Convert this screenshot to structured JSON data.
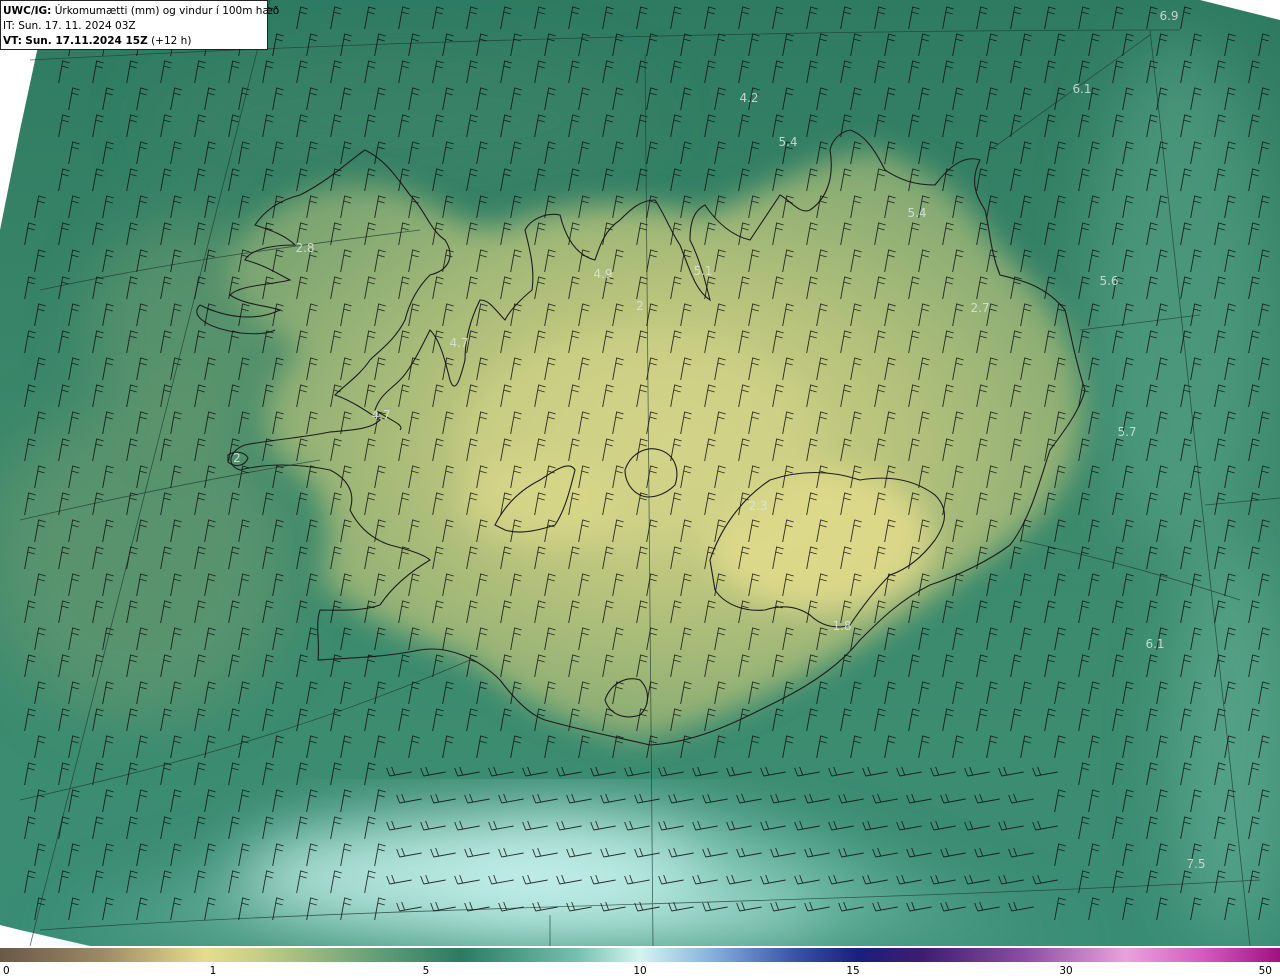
{
  "header": {
    "model": "UWC/IG:",
    "title": "Úrkomumætti (mm) og vindur í 100m hæð",
    "initial_time": "IT: Sun. 17. 11. 2024 03Z",
    "valid_prefix": "VT:",
    "valid_time": "Sun. 17.11.2024 15Z",
    "lead": "(+12 h)"
  },
  "colorbar": {
    "ticks": [
      "0",
      "1",
      "5",
      "10",
      "15",
      "30",
      "50"
    ],
    "colors": [
      "#6b5a49",
      "#9c8a66",
      "#d9cf84",
      "#f2ec9a",
      "#7ea777",
      "#2c7a5e",
      "#8fd3c3",
      "#dff6f2",
      "#5c86b7",
      "#1d2a8c",
      "#3b1f73",
      "#a55ab5",
      "#e29ad7",
      "#b3189b"
    ]
  },
  "map": {
    "background_colors": {
      "sea_dark": "#2c7863",
      "sea_mid": "#3f8a6e",
      "land_light": "#b8c67c",
      "land_peak": "#d9d688",
      "south_cyan": "#a8e3dc"
    },
    "value_labels": [
      {
        "text": "6.9"
      },
      {
        "text": "4.2"
      },
      {
        "text": "6.1"
      },
      {
        "text": "5.4"
      },
      {
        "text": "5.4"
      },
      {
        "text": "2.8"
      },
      {
        "text": "4.9"
      },
      {
        "text": "5.1"
      },
      {
        "text": "5.6"
      },
      {
        "text": "2.7"
      },
      {
        "text": "2"
      },
      {
        "text": "4.7"
      },
      {
        "text": "4.7"
      },
      {
        "text": "5.7"
      },
      {
        "text": "2"
      },
      {
        "text": "2.3"
      },
      {
        "text": "6.1"
      },
      {
        "text": "7.5"
      },
      {
        "text": "1.8"
      }
    ]
  }
}
